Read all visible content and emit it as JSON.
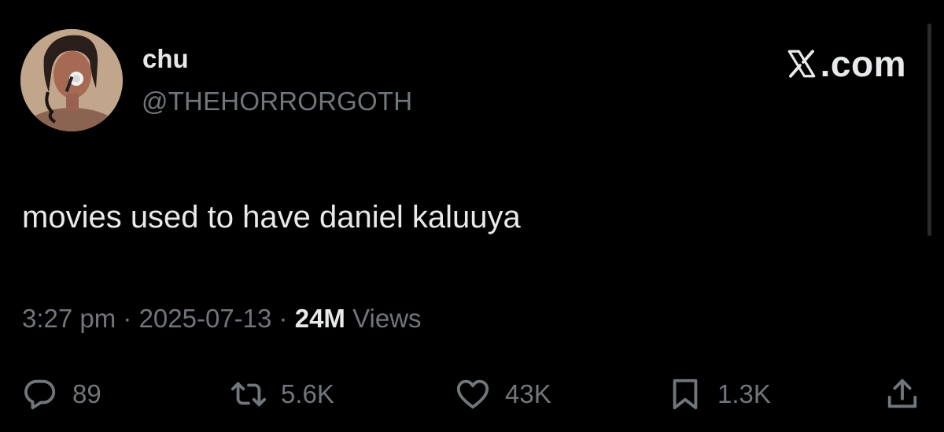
{
  "author": {
    "name": "chu",
    "handle": "@THEHORRORGOTH"
  },
  "brand": {
    "text": ".com"
  },
  "tweet": {
    "text": "movies used to have daniel kaluuya"
  },
  "meta": {
    "time": "3:27 pm",
    "separator": " · ",
    "date": "2025-07-13",
    "views_count": "24M",
    "views_label": " Views"
  },
  "actions": {
    "replies": "89",
    "reposts": "5.6K",
    "likes": "43K",
    "bookmarks": "1.3K"
  },
  "icons": {
    "reply": "reply-bubble-icon",
    "repost": "repost-arrows-icon",
    "like": "heart-icon",
    "bookmark": "bookmark-icon",
    "share": "share-upload-icon",
    "brand": "x-logo-icon"
  },
  "colors": {
    "background": "#000000",
    "primary_text": "#e7e9ea",
    "secondary_text": "#71767b"
  }
}
